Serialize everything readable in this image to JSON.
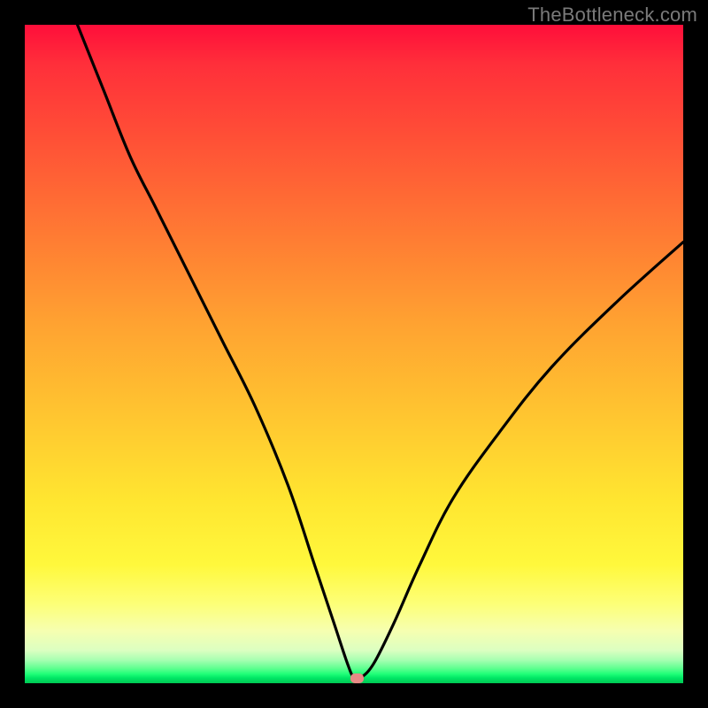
{
  "watermark": "TheBottleneck.com",
  "chart_data": {
    "type": "line",
    "title": "",
    "xlabel": "",
    "ylabel": "",
    "xlim": [
      0,
      100
    ],
    "ylim": [
      0,
      100
    ],
    "series": [
      {
        "name": "bottleneck-curve",
        "x": [
          8,
          12,
          16,
          20,
          25,
          30,
          35,
          40,
          44,
          47,
          49,
          50,
          51,
          53,
          56,
          60,
          65,
          72,
          80,
          90,
          100
        ],
        "values": [
          100,
          90,
          80,
          72,
          62,
          52,
          42,
          30,
          18,
          9,
          3,
          0.8,
          0.8,
          3,
          9,
          18,
          28,
          38,
          48,
          58,
          67
        ]
      }
    ],
    "marker": {
      "x": 50.5,
      "y": 0.8,
      "color": "#e88a86"
    },
    "background_gradient": {
      "direction": "vertical",
      "stops": [
        {
          "pos": 0,
          "color": "#ff0e3a"
        },
        {
          "pos": 50,
          "color": "#ffa431"
        },
        {
          "pos": 82,
          "color": "#fff83c"
        },
        {
          "pos": 96,
          "color": "#a6ffb1"
        },
        {
          "pos": 100,
          "color": "#00c853"
        }
      ]
    }
  }
}
